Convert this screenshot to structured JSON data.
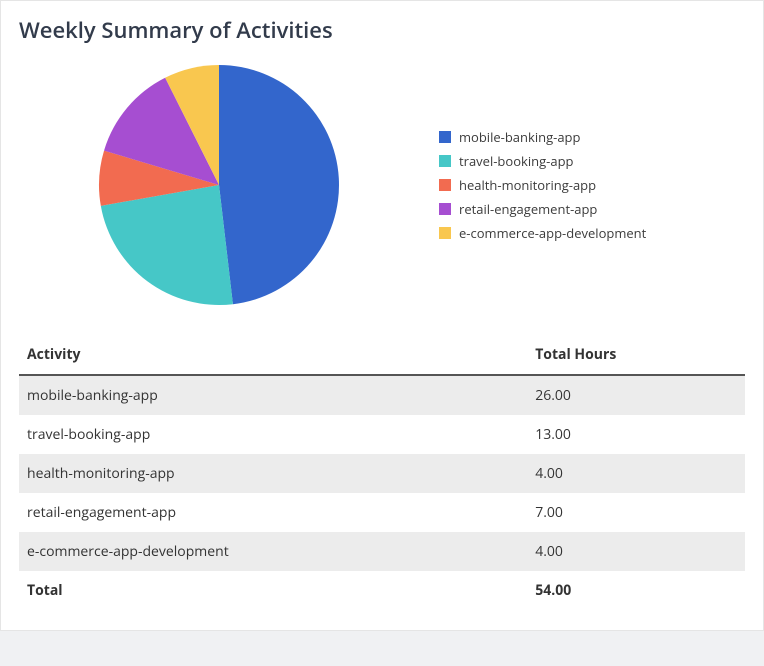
{
  "title": "Weekly Summary of Activities",
  "colors": {
    "mobile-banking-app": "#3366cc",
    "travel-booking-app": "#46c7c7",
    "health-monitoring-app": "#f26b50",
    "retail-engagement-app": "#a64ed1",
    "e-commerce-app-development": "#f9c74f"
  },
  "chart_data": {
    "type": "pie",
    "title": "Weekly Summary of Activities",
    "series": [
      {
        "name": "mobile-banking-app",
        "value": 26.0
      },
      {
        "name": "travel-booking-app",
        "value": 13.0
      },
      {
        "name": "health-monitoring-app",
        "value": 4.0
      },
      {
        "name": "retail-engagement-app",
        "value": 7.0
      },
      {
        "name": "e-commerce-app-development",
        "value": 4.0
      }
    ],
    "total": 54.0,
    "legend_position": "right"
  },
  "table": {
    "headers": {
      "activity": "Activity",
      "hours": "Total Hours"
    },
    "rows": [
      {
        "activity": "mobile-banking-app",
        "hours": "26.00"
      },
      {
        "activity": "travel-booking-app",
        "hours": "13.00"
      },
      {
        "activity": "health-monitoring-app",
        "hours": "4.00"
      },
      {
        "activity": "retail-engagement-app",
        "hours": "7.00"
      },
      {
        "activity": "e-commerce-app-development",
        "hours": "4.00"
      }
    ],
    "total_row": {
      "label": "Total",
      "hours": "54.00"
    }
  },
  "legend": [
    {
      "key": "mobile-banking-app",
      "label": "mobile-banking-app"
    },
    {
      "key": "travel-booking-app",
      "label": "travel-booking-app"
    },
    {
      "key": "health-monitoring-app",
      "label": "health-monitoring-app"
    },
    {
      "key": "retail-engagement-app",
      "label": "retail-engagement-app"
    },
    {
      "key": "e-commerce-app-development",
      "label": "e-commerce-app-development"
    }
  ]
}
